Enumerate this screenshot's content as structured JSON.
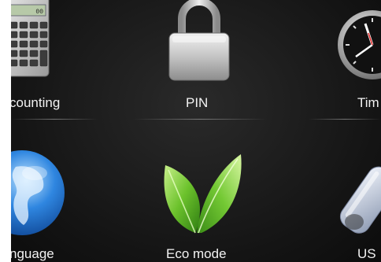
{
  "tiles": [
    {
      "id": "accounting",
      "label": "counting",
      "icon": "calculator-icon"
    },
    {
      "id": "pin",
      "label": "PIN",
      "icon": "padlock-icon"
    },
    {
      "id": "time",
      "label": "Tim",
      "icon": "clock-icon"
    },
    {
      "id": "language",
      "label": "nguage",
      "icon": "globe-icon"
    },
    {
      "id": "eco",
      "label": "Eco mode",
      "icon": "leaf-icon"
    },
    {
      "id": "usb",
      "label": "US",
      "icon": "usb-drive-icon"
    }
  ],
  "calculator_display": "00",
  "colors": {
    "background": "#141414",
    "leaf_green": "#5fb82a",
    "globe_blue": "#1d6fd1",
    "lock_silver": "#c9c9c9"
  }
}
